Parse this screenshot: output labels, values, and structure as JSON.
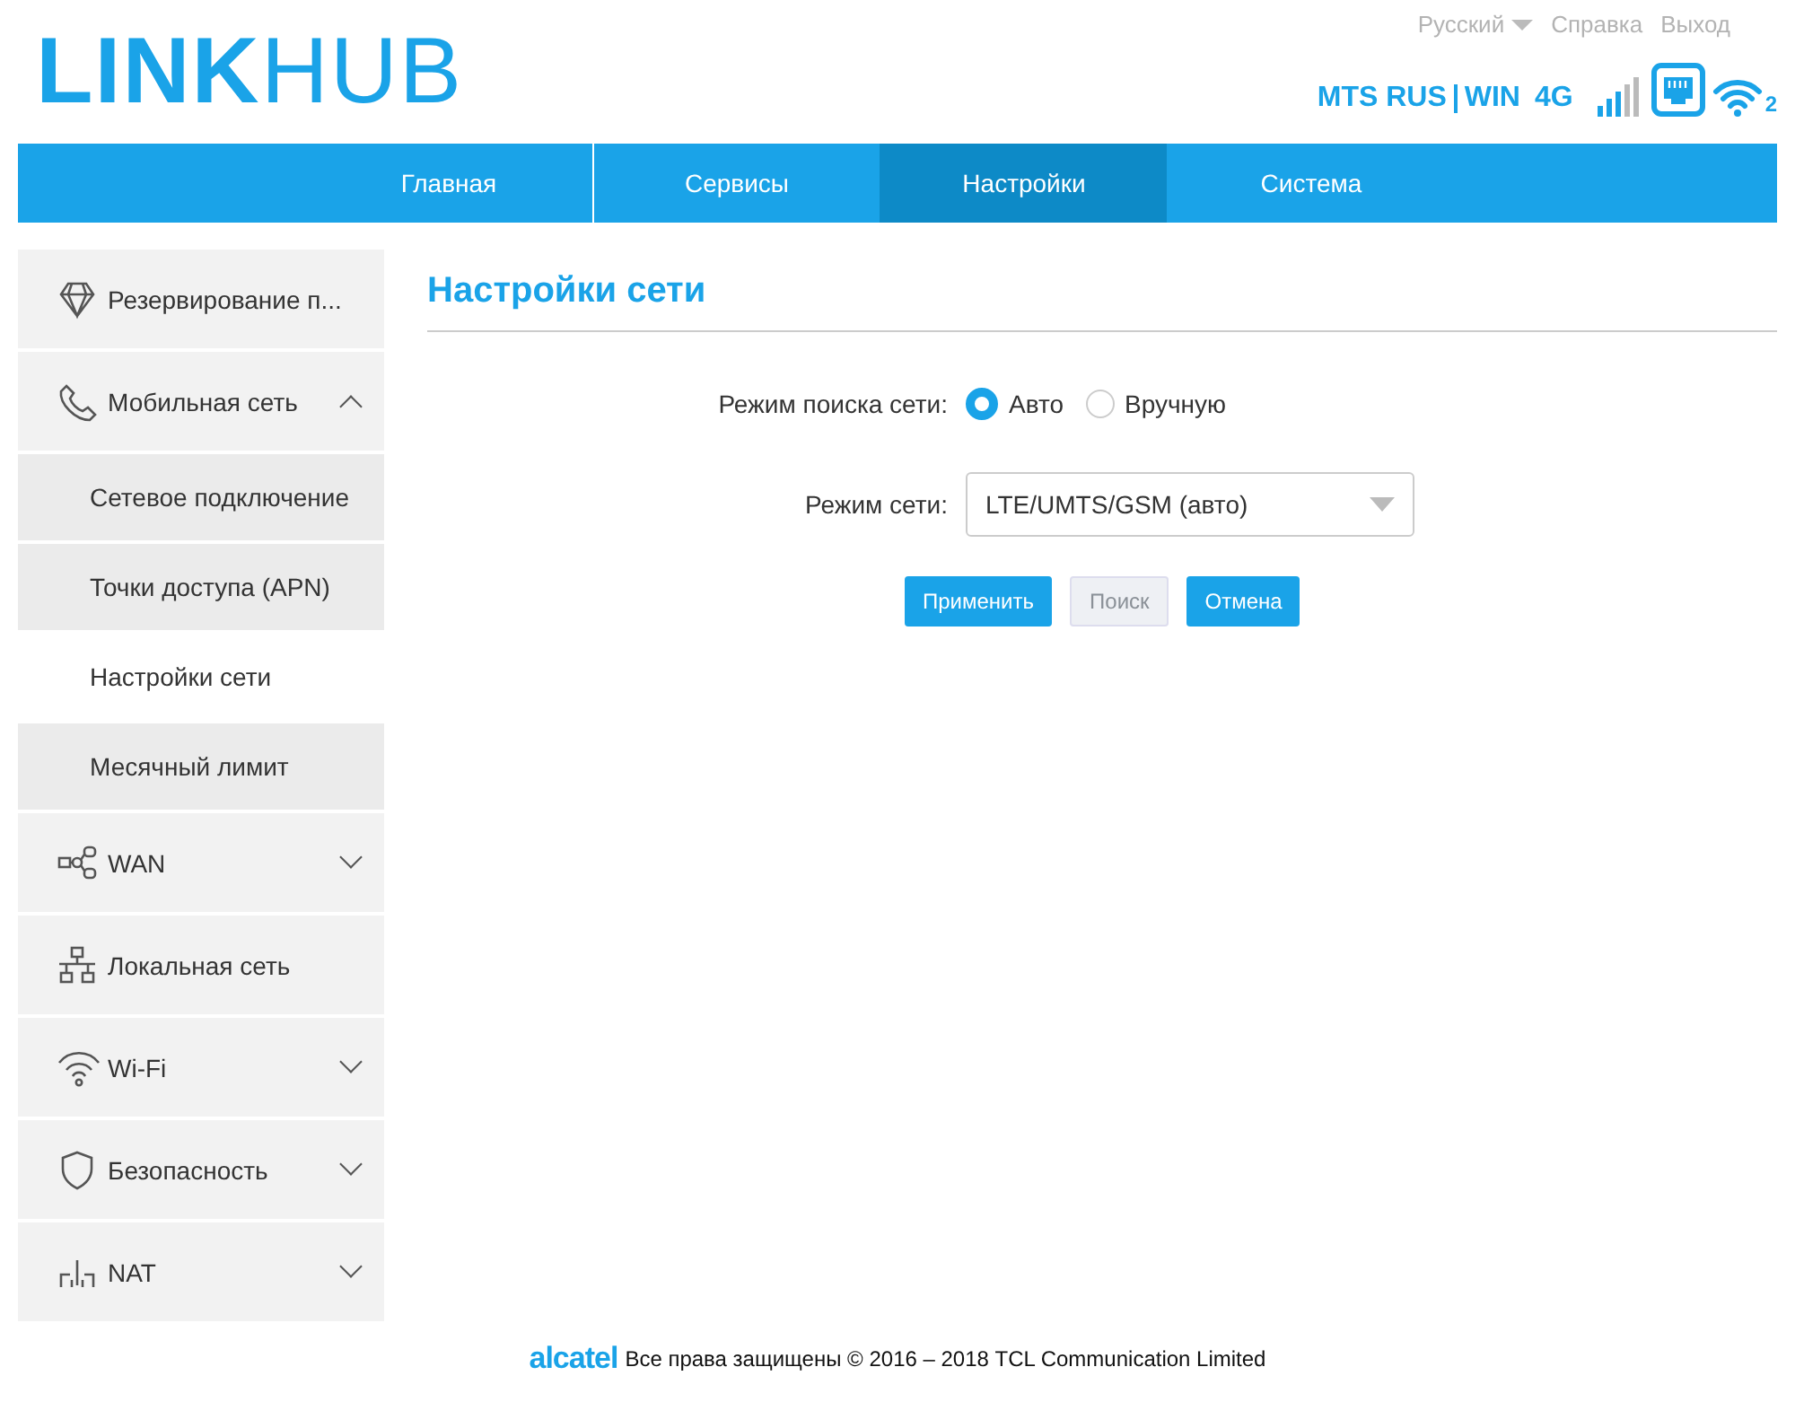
{
  "header": {
    "logo": "**LINK**HUB",
    "language": "Русский",
    "links": [
      "Справка",
      "Выход"
    ],
    "operator": "MTS RUS",
    "network": "WIN",
    "technology": "4G",
    "wifi_clients": "2"
  },
  "nav": [
    {
      "label": "Главная",
      "selected": false
    },
    {
      "label": "Сервисы",
      "selected": false
    },
    {
      "label": "Настройки",
      "selected": true
    },
    {
      "label": "Система",
      "selected": false
    }
  ],
  "sidebar": [
    {
      "kind": "group",
      "label": "Резервирование п..."
    },
    {
      "kind": "group",
      "label": "Мобильная сеть",
      "expanded": true,
      "children": [
        {
          "label": "Сетевое подключение",
          "selected": false
        },
        {
          "label": "Точки доступа (APN)",
          "selected": false
        },
        {
          "label": "Настройки сети",
          "selected": true
        },
        {
          "label": "Месячный лимит",
          "selected": false
        }
      ]
    },
    {
      "kind": "group",
      "label": "WAN",
      "expanded": false
    },
    {
      "kind": "group",
      "label": "Локальная сеть"
    },
    {
      "kind": "group",
      "label": "Wi-Fi",
      "expanded": false
    },
    {
      "kind": "group",
      "label": "Безопасность",
      "expanded": false
    },
    {
      "kind": "group",
      "label": "NAT",
      "expanded": false
    }
  ],
  "content": {
    "title": "Настройки сети",
    "search_mode": {
      "label": "Режим поиска сети:",
      "options": [
        {
          "label": "Авто",
          "selected": true
        },
        {
          "label": "Вручную",
          "selected": false
        }
      ]
    },
    "network_mode": {
      "label": "Режим сети:",
      "value": "LTE/UMTS/GSM (авто)"
    },
    "buttons": [
      {
        "label": "Применить",
        "disabled": false
      },
      {
        "label": "Поиск",
        "disabled": true
      },
      {
        "label": "Отмена",
        "disabled": false
      }
    ]
  },
  "footer": {
    "brand": "alcatel",
    "text": "Все права защищены © 2016 – 2018 TCL Communication Limited"
  }
}
